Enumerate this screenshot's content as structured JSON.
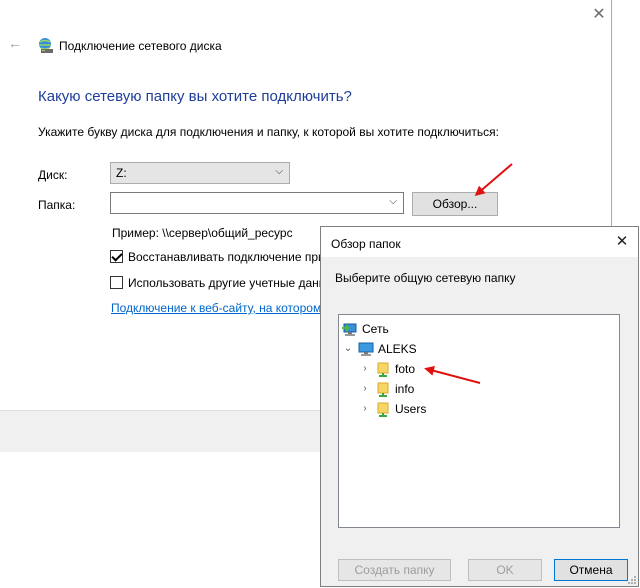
{
  "wizard": {
    "title": "Подключение сетевого диска",
    "close_glyph": "✕",
    "heading": "Какую сетевую папку вы хотите подключить?",
    "instruction": "Укажите букву диска для подключения и папку, к которой вы хотите подключиться:",
    "drive_label": "Диск:",
    "drive_value": "Z:",
    "folder_label": "Папка:",
    "folder_value": "",
    "browse_label": "Обзор...",
    "example_text": "Пример: \\\\сервер\\общий_ресурс",
    "reconnect_label": "Восстанавливать подключение при",
    "reconnect_checked": true,
    "other_credentials_label": "Использовать другие учетные данн",
    "other_credentials_checked": false,
    "website_link": "Подключение к веб-сайту, на котором"
  },
  "browse_dialog": {
    "title": "Обзор папок",
    "prompt": "Выберите общую сетевую папку",
    "tree": {
      "root": "Сеть",
      "computer": "ALEKS",
      "folders": [
        "foto",
        "info",
        "Users"
      ]
    },
    "new_folder_label": "Создать папку",
    "ok_label": "OK",
    "cancel_label": "Отмена"
  },
  "colors": {
    "heading": "#1e3e9a",
    "link": "#0066cc",
    "annotation_arrow": "#e01010",
    "focus_border": "#0078d7"
  },
  "icons": {
    "back": "back-arrow-icon",
    "network_drive": "network-drive-icon",
    "network": "network-icon",
    "computer": "computer-icon",
    "shared_folder": "shared-folder-icon"
  }
}
